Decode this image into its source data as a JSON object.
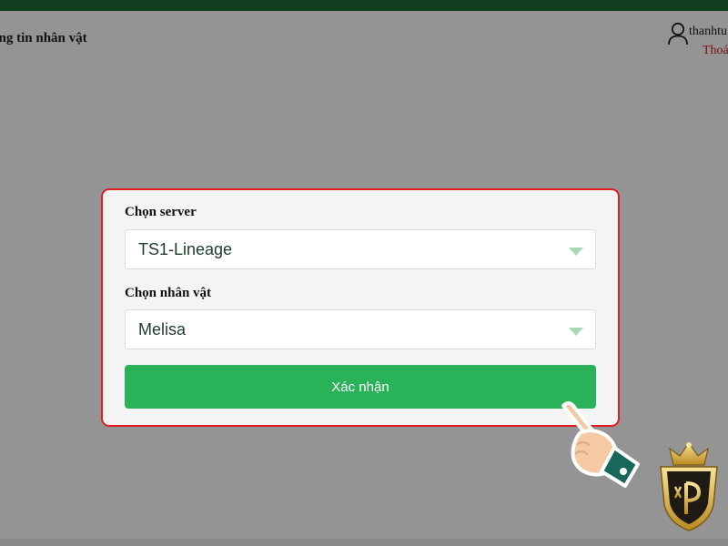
{
  "header": {
    "title": "ông tin nhân vật",
    "username": "thanhtu",
    "logout_label": "Thoá"
  },
  "icons": {
    "user": "user-outline-icon",
    "caret": "chevron-down-icon",
    "hand": "pointing-hand-icon",
    "logo": "crown-logo-icon"
  },
  "colors": {
    "topbar": "#1d6a35",
    "modal_border": "#e11d24",
    "confirm_button": "#29b257",
    "logout": "#d21f1f"
  },
  "modal": {
    "server_label": "Chọn server",
    "server_selected": "TS1-Lineage",
    "character_label": "Chọn nhân vật",
    "character_selected": "Melisa",
    "confirm_label": "Xác nhận"
  }
}
